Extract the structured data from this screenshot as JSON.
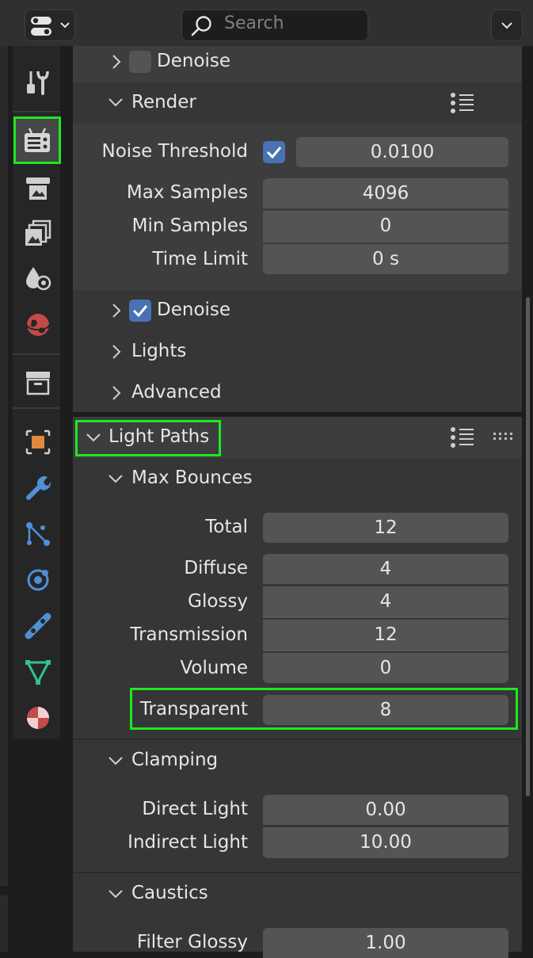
{
  "header": {
    "editor_type_icon": "editor-type-icon",
    "search_placeholder": "Search",
    "options_icon": "chevron-down-icon"
  },
  "tabs": [
    {
      "name": "tool-tab",
      "icon": "tool-icon"
    },
    {
      "name": "render-tab",
      "icon": "render-icon",
      "selected": true
    },
    {
      "name": "output-tab",
      "icon": "output-icon"
    },
    {
      "name": "view-layer-tab",
      "icon": "view-layer-icon"
    },
    {
      "name": "scene-tab",
      "icon": "scene-icon"
    },
    {
      "name": "world-tab",
      "icon": "world-icon"
    },
    {
      "name": "collection-tab",
      "icon": "collection-icon"
    },
    {
      "name": "object-tab",
      "icon": "object-icon"
    },
    {
      "name": "modifiers-tab",
      "icon": "wrench-icon"
    },
    {
      "name": "particles-tab",
      "icon": "particles-icon"
    },
    {
      "name": "physics-tab",
      "icon": "physics-icon"
    },
    {
      "name": "constraints-tab",
      "icon": "constraints-icon"
    },
    {
      "name": "data-tab",
      "icon": "mesh-data-icon"
    },
    {
      "name": "material-tab",
      "icon": "material-icon"
    }
  ],
  "sampling": {
    "viewport_denoise_label": "Denoise",
    "viewport_denoise_checked": false,
    "render_label": "Render",
    "noise_threshold_label": "Noise Threshold",
    "noise_threshold_enabled": true,
    "noise_threshold_value": "0.0100",
    "max_samples_label": "Max Samples",
    "max_samples_value": "4096",
    "min_samples_label": "Min Samples",
    "min_samples_value": "0",
    "time_limit_label": "Time Limit",
    "time_limit_value": "0 s",
    "render_denoise_label": "Denoise",
    "render_denoise_checked": true,
    "lights_label": "Lights",
    "advanced_label": "Advanced"
  },
  "light_paths": {
    "title": "Light Paths",
    "max_bounces": {
      "label": "Max Bounces",
      "total_label": "Total",
      "total_value": "12",
      "diffuse_label": "Diffuse",
      "diffuse_value": "4",
      "glossy_label": "Glossy",
      "glossy_value": "4",
      "transmission_label": "Transmission",
      "transmission_value": "12",
      "volume_label": "Volume",
      "volume_value": "0",
      "transparent_label": "Transparent",
      "transparent_value": "8"
    },
    "clamping": {
      "label": "Clamping",
      "direct_label": "Direct Light",
      "direct_value": "0.00",
      "indirect_label": "Indirect Light",
      "indirect_value": "10.00"
    },
    "caustics": {
      "label": "Caustics",
      "filter_glossy_label": "Filter Glossy",
      "filter_glossy_value": "1.00"
    }
  },
  "colors": {
    "highlight": "#1ee81e",
    "checkbox_on": "#4772b3",
    "panel": "#3d3d3d",
    "field": "#545454"
  }
}
